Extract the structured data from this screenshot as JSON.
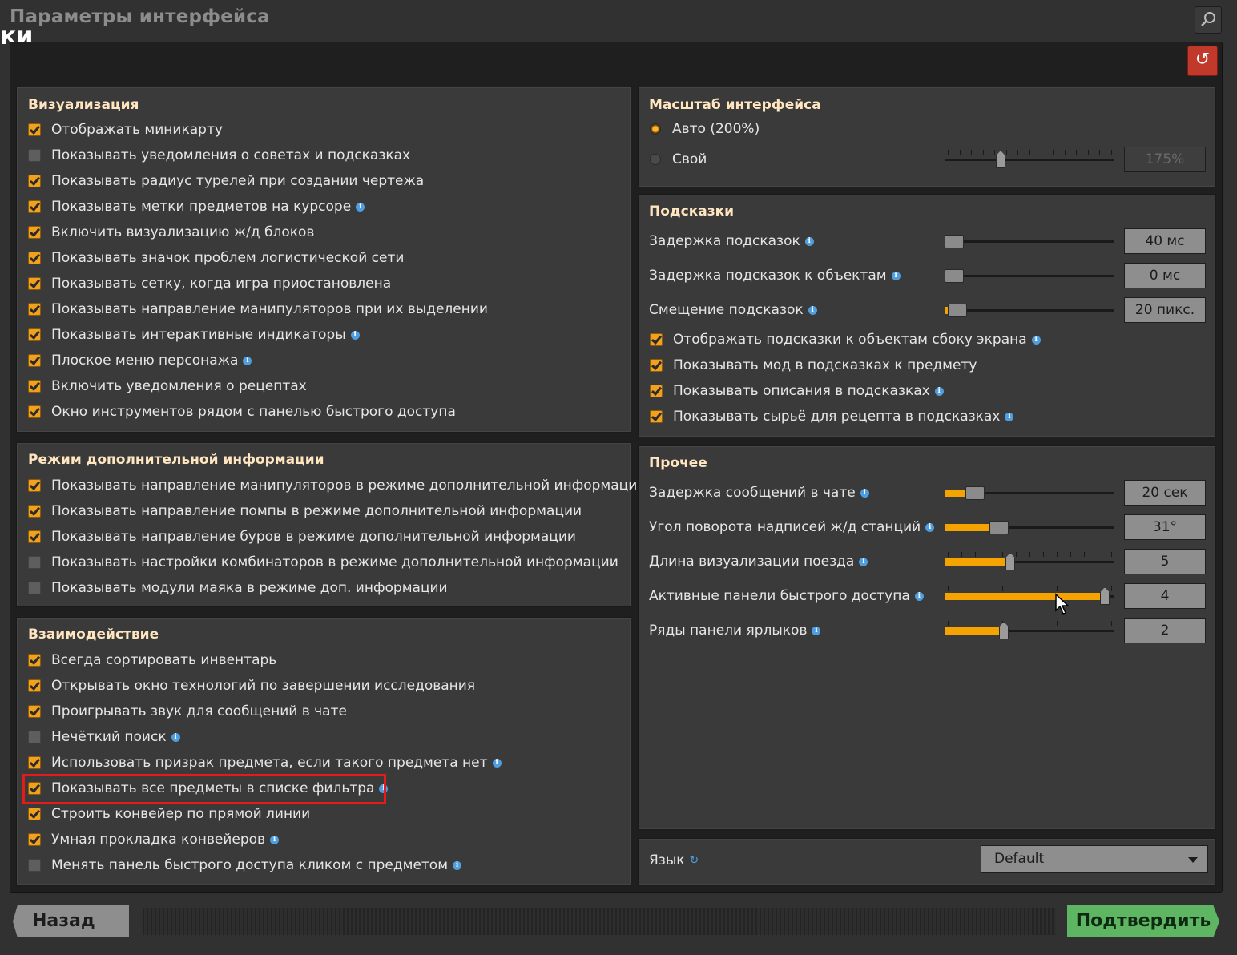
{
  "window_title": "Параметры интерфейса",
  "bg_fragment": "ки",
  "visualization": {
    "heading": "Визуализация",
    "items": [
      {
        "label": "Отображать миникарту",
        "checked": true,
        "info": false
      },
      {
        "label": "Показывать уведомления о советах и подсказках",
        "checked": false,
        "info": false
      },
      {
        "label": "Показывать радиус турелей при создании чертежа",
        "checked": true,
        "info": false
      },
      {
        "label": "Показывать метки предметов на курсоре",
        "checked": true,
        "info": true
      },
      {
        "label": "Включить визуализацию ж/д блоков",
        "checked": true,
        "info": false
      },
      {
        "label": "Показывать значок проблем логистической сети",
        "checked": true,
        "info": false
      },
      {
        "label": "Показывать сетку, когда игра приостановлена",
        "checked": true,
        "info": false
      },
      {
        "label": "Показывать направление манипуляторов при их выделении",
        "checked": true,
        "info": false
      },
      {
        "label": "Показывать интерактивные индикаторы",
        "checked": true,
        "info": true
      },
      {
        "label": "Плоское меню персонажа",
        "checked": true,
        "info": true
      },
      {
        "label": "Включить уведомления о рецептах",
        "checked": true,
        "info": false
      },
      {
        "label": "Окно инструментов рядом с панелью быстрого доступа",
        "checked": true,
        "info": false
      }
    ]
  },
  "alt_mode": {
    "heading": "Режим дополнительной информации",
    "items": [
      {
        "label": "Показывать направление манипуляторов в режиме дополнительной информации",
        "checked": true,
        "info": false
      },
      {
        "label": "Показывать направление помпы в режиме дополнительной информации",
        "checked": true,
        "info": false
      },
      {
        "label": "Показывать направление буров в режиме дополнительной информации",
        "checked": true,
        "info": false
      },
      {
        "label": "Показывать настройки комбинаторов в режиме дополнительной информации",
        "checked": false,
        "info": false
      },
      {
        "label": "Показывать модули маяка в режиме доп. информации",
        "checked": false,
        "info": false
      }
    ]
  },
  "interaction": {
    "heading": "Взаимодействие",
    "items": [
      {
        "label": "Всегда сортировать инвентарь",
        "checked": true,
        "info": false
      },
      {
        "label": "Открывать окно технологий по завершении исследования",
        "checked": true,
        "info": false
      },
      {
        "label": "Проигрывать звук для сообщений в чате",
        "checked": true,
        "info": false
      },
      {
        "label": "Нечёткий поиск",
        "checked": false,
        "info": true
      },
      {
        "label": "Использовать призрак предмета, если такого предмета нет",
        "checked": true,
        "info": true
      },
      {
        "label": "Показывать все предметы в списке фильтра",
        "checked": true,
        "info": true
      },
      {
        "label": "Строить конвейер по прямой линии",
        "checked": true,
        "info": false
      },
      {
        "label": "Умная прокладка конвейеров",
        "checked": true,
        "info": true
      },
      {
        "label": "Менять панель быстрого доступа кликом с предметом",
        "checked": false,
        "info": true
      }
    ]
  },
  "scale": {
    "heading": "Масштаб интерфейса",
    "auto_label": "Авто (200%)",
    "custom_label": "Свой",
    "custom_value": "175%",
    "selected": "auto",
    "slider_fraction": 0.32
  },
  "tooltips": {
    "heading": "Подсказки",
    "sliders": [
      {
        "label": "Задержка подсказок",
        "value": "40 мс",
        "fraction": 0.0
      },
      {
        "label": "Задержка подсказок к объектам",
        "value": "0 мс",
        "fraction": 0.0
      },
      {
        "label": "Смещение подсказок",
        "value": "20 пикс.",
        "fraction": 0.02
      }
    ],
    "items": [
      {
        "label": "Отображать подсказки к объектам сбоку экрана",
        "checked": true,
        "info": true
      },
      {
        "label": "Показывать мод в подсказках к предмету",
        "checked": true,
        "info": false
      },
      {
        "label": "Показывать описания в подсказках",
        "checked": true,
        "info": true
      },
      {
        "label": "Показывать сырьё для рецепта в подсказках",
        "checked": true,
        "info": true
      }
    ]
  },
  "misc": {
    "heading": "Прочее",
    "sliders": [
      {
        "label": "Задержка сообщений в чате",
        "value": "20 сек",
        "fraction": 0.14
      },
      {
        "label": "Угол поворота надписей ж/д станций",
        "value": "31°",
        "fraction": 0.3
      },
      {
        "label": "Длина визуализации поезда",
        "value": "5",
        "fraction": 0.38
      },
      {
        "label": "Активные панели быстрого доступа",
        "value": "4",
        "fraction": 0.97
      },
      {
        "label": "Ряды панели ярлыков",
        "value": "2",
        "fraction": 0.34
      }
    ]
  },
  "language": {
    "label": "Язык",
    "selected": "Default"
  },
  "footer": {
    "back": "Назад",
    "confirm": "Подтвердить"
  },
  "colors": {
    "accent": "#f5a300",
    "confirm": "#5eb663",
    "reset": "#c0392b",
    "highlight": "#e31b1b"
  }
}
